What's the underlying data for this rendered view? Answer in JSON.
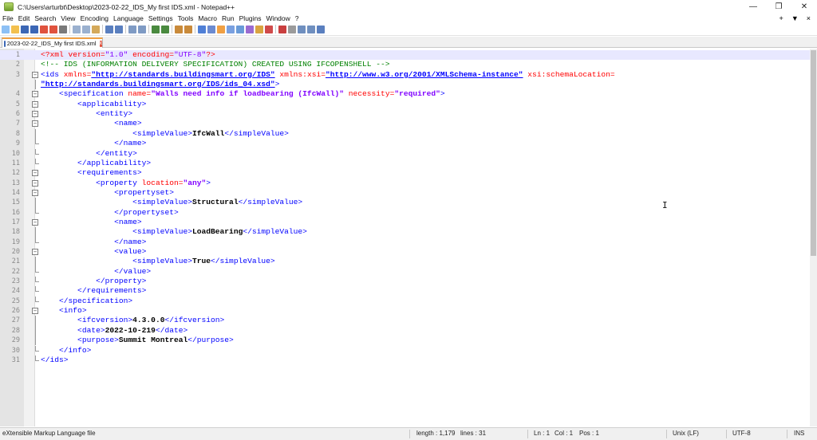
{
  "window": {
    "title": "C:\\Users\\arturbt\\Desktop\\2023-02-22_IDS_My first IDS.xml - Notepad++",
    "controls": [
      "minimize-icon",
      "maximize-icon",
      "close-icon"
    ]
  },
  "menu": {
    "items": [
      "File",
      "Edit",
      "Search",
      "View",
      "Encoding",
      "Language",
      "Settings",
      "Tools",
      "Macro",
      "Run",
      "Plugins",
      "Window",
      "?"
    ],
    "right": [
      "+",
      "▼",
      "×"
    ]
  },
  "toolbar": {
    "buttons": [
      "new-file-icon",
      "open-file-icon",
      "save-icon",
      "save-all-icon",
      "close-icon",
      "close-all-icon",
      "print-icon",
      "cut-icon",
      "copy-icon",
      "paste-icon",
      "undo-icon",
      "redo-icon",
      "find-icon",
      "replace-icon",
      "zoom-in-icon",
      "zoom-out-icon",
      "sync-vertical-icon",
      "sync-horizontal-icon",
      "word-wrap-icon",
      "show-all-chars-icon",
      "indent-guide-icon",
      "udl-icon",
      "doc-map-icon",
      "function-list-icon",
      "folder-workspace-icon",
      "monitoring-icon",
      "record-macro-icon",
      "stop-macro-icon",
      "play-macro-icon",
      "run-macro-multiple-icon",
      "save-macro-icon"
    ]
  },
  "tab": {
    "label": "2023-02-22_IDS_My first IDS.xml"
  },
  "editor": {
    "current_line": 1,
    "lines": [
      {
        "n": "1",
        "fold": "",
        "segs": [
          [
            "t-decl",
            "<?xml "
          ],
          [
            "t-decl",
            "version="
          ],
          [
            "t-decl-val",
            "\"1.0\""
          ],
          [
            "t-decl",
            " encoding="
          ],
          [
            "t-decl-val",
            "\"UTF-8\""
          ],
          [
            "t-decl",
            "?>"
          ]
        ]
      },
      {
        "n": "2",
        "fold": "",
        "segs": [
          [
            "t-comment",
            "<!-- IDS (INFORMATION DELIVERY SPECIFICATION) CREATED USING IFCOPENSHELL -->"
          ]
        ]
      },
      {
        "n": "3",
        "fold": "box",
        "segs": [
          [
            "t-tag",
            "<ids "
          ],
          [
            "t-attr",
            "xmlns="
          ],
          [
            "t-link",
            "\"http://standards.buildingsmart.org/IDS\""
          ],
          [
            "t-attr",
            " xmlns:xsi="
          ],
          [
            "t-link",
            "\"http://www.w3.org/2001/XMLSchema-instance\""
          ],
          [
            "t-attr",
            " xsi:schemaLocation="
          ]
        ]
      },
      {
        "n": "",
        "fold": "line",
        "segs": [
          [
            "t-link",
            "\"http://standards.buildingsmart.org/IDS/ids_04.xsd\""
          ],
          [
            "t-tag",
            ">"
          ]
        ]
      },
      {
        "n": "4",
        "fold": "box",
        "segs": [
          [
            "t-tag",
            "    <specification "
          ],
          [
            "t-attr",
            "name="
          ],
          [
            "t-val",
            "\"Walls need info if loadbearing (IfcWall)\""
          ],
          [
            "t-attr",
            " necessity="
          ],
          [
            "t-val",
            "\"required\""
          ],
          [
            "t-tag",
            ">"
          ]
        ]
      },
      {
        "n": "5",
        "fold": "box",
        "segs": [
          [
            "t-tag",
            "        <applicability>"
          ]
        ]
      },
      {
        "n": "6",
        "fold": "box",
        "segs": [
          [
            "t-tag",
            "            <entity>"
          ]
        ]
      },
      {
        "n": "7",
        "fold": "box",
        "segs": [
          [
            "t-tag",
            "                <name>"
          ]
        ]
      },
      {
        "n": "8",
        "fold": "line",
        "segs": [
          [
            "t-tag",
            "                    <simpleValue>"
          ],
          [
            "t-text",
            "IfcWall"
          ],
          [
            "t-tag",
            "</simpleValue>"
          ]
        ]
      },
      {
        "n": "9",
        "fold": "end",
        "segs": [
          [
            "t-tag",
            "                </name>"
          ]
        ]
      },
      {
        "n": "10",
        "fold": "end",
        "segs": [
          [
            "t-tag",
            "            </entity>"
          ]
        ]
      },
      {
        "n": "11",
        "fold": "end",
        "segs": [
          [
            "t-tag",
            "        </applicability>"
          ]
        ]
      },
      {
        "n": "12",
        "fold": "box",
        "segs": [
          [
            "t-tag",
            "        <requirements>"
          ]
        ]
      },
      {
        "n": "13",
        "fold": "box",
        "segs": [
          [
            "t-tag",
            "            <property "
          ],
          [
            "t-attr",
            "location="
          ],
          [
            "t-val",
            "\"any\""
          ],
          [
            "t-tag",
            ">"
          ]
        ]
      },
      {
        "n": "14",
        "fold": "box",
        "segs": [
          [
            "t-tag",
            "                <propertyset>"
          ]
        ]
      },
      {
        "n": "15",
        "fold": "line",
        "segs": [
          [
            "t-tag",
            "                    <simpleValue>"
          ],
          [
            "t-text",
            "Structural"
          ],
          [
            "t-tag",
            "</simpleValue>"
          ]
        ]
      },
      {
        "n": "16",
        "fold": "end",
        "segs": [
          [
            "t-tag",
            "                </propertyset>"
          ]
        ]
      },
      {
        "n": "17",
        "fold": "box",
        "segs": [
          [
            "t-tag",
            "                <name>"
          ]
        ]
      },
      {
        "n": "18",
        "fold": "line",
        "segs": [
          [
            "t-tag",
            "                    <simpleValue>"
          ],
          [
            "t-text",
            "LoadBearing"
          ],
          [
            "t-tag",
            "</simpleValue>"
          ]
        ]
      },
      {
        "n": "19",
        "fold": "end",
        "segs": [
          [
            "t-tag",
            "                </name>"
          ]
        ]
      },
      {
        "n": "20",
        "fold": "box",
        "segs": [
          [
            "t-tag",
            "                <value>"
          ]
        ]
      },
      {
        "n": "21",
        "fold": "line",
        "segs": [
          [
            "t-tag",
            "                    <simpleValue>"
          ],
          [
            "t-text",
            "True"
          ],
          [
            "t-tag",
            "</simpleValue>"
          ]
        ]
      },
      {
        "n": "22",
        "fold": "end",
        "segs": [
          [
            "t-tag",
            "                </value>"
          ]
        ]
      },
      {
        "n": "23",
        "fold": "end",
        "segs": [
          [
            "t-tag",
            "            </property>"
          ]
        ]
      },
      {
        "n": "24",
        "fold": "end",
        "segs": [
          [
            "t-tag",
            "        </requirements>"
          ]
        ]
      },
      {
        "n": "25",
        "fold": "end",
        "segs": [
          [
            "t-tag",
            "    </specification>"
          ]
        ]
      },
      {
        "n": "26",
        "fold": "box",
        "segs": [
          [
            "t-tag",
            "    <info>"
          ]
        ]
      },
      {
        "n": "27",
        "fold": "line",
        "segs": [
          [
            "t-tag",
            "        <ifcversion>"
          ],
          [
            "t-text",
            "4.3.0.0"
          ],
          [
            "t-tag",
            "</ifcversion>"
          ]
        ]
      },
      {
        "n": "28",
        "fold": "line",
        "segs": [
          [
            "t-tag",
            "        <date>"
          ],
          [
            "t-text",
            "2022-10-219"
          ],
          [
            "t-tag",
            "</date>"
          ]
        ]
      },
      {
        "n": "29",
        "fold": "line",
        "segs": [
          [
            "t-tag",
            "        <purpose>"
          ],
          [
            "t-text",
            "Summit Montreal"
          ],
          [
            "t-tag",
            "</purpose>"
          ]
        ]
      },
      {
        "n": "30",
        "fold": "end",
        "segs": [
          [
            "t-tag",
            "    </info>"
          ]
        ]
      },
      {
        "n": "31",
        "fold": "end",
        "segs": [
          [
            "t-tag",
            "</ids>"
          ]
        ]
      }
    ]
  },
  "status": {
    "file_type": "eXtensible Markup Language file",
    "length": "length : 1,179",
    "lines": "lines : 31",
    "ln": "Ln : 1",
    "col": "Col : 1",
    "pos": "Pos : 1",
    "eol": "Unix (LF)",
    "encoding": "UTF-8",
    "mode": "INS"
  },
  "colors": {
    "tag": "#0000ff",
    "attribute": "#ff0000",
    "value": "#8000ff",
    "comment": "#008000",
    "text": "#000000",
    "tab_accent": "#f0a044"
  }
}
